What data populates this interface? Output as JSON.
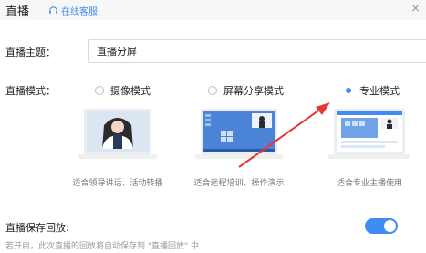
{
  "header": {
    "title": "直播",
    "support_label": "在线客服",
    "close": "×"
  },
  "topic": {
    "label": "直播主题：",
    "value": "直播分屏"
  },
  "mode": {
    "label": "直播模式：",
    "options": [
      {
        "label": "摄像模式",
        "caption": "适合领导讲话、活动转播",
        "selected": false
      },
      {
        "label": "屏幕分享模式",
        "caption": "适合远程培训、操作演示",
        "selected": false
      },
      {
        "label": "专业模式",
        "caption": "适合专业主播使用",
        "selected": true
      }
    ]
  },
  "save": {
    "label": "直播保存回放:",
    "hint": "若开启，此次直播的回放将自动保存到 \"直播回放\" 中",
    "enabled": true
  },
  "colors": {
    "accent": "#3f8cf2",
    "arrow": "#e53935"
  }
}
